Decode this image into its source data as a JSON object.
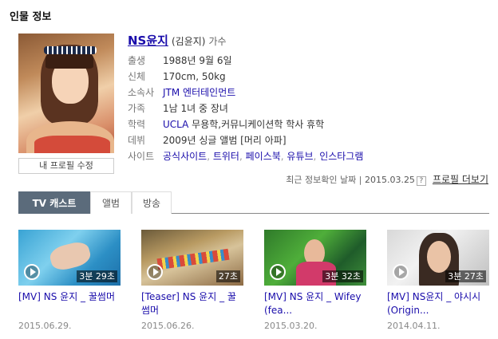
{
  "section": {
    "title": "인물 정보"
  },
  "profile": {
    "name": "NS윤지",
    "real_name": "(김윤지)",
    "job": "가수",
    "edit_button": "내 프로필 수정",
    "rows": [
      {
        "label": "출생",
        "value": "1988년 9월 6일"
      },
      {
        "label": "신체",
        "value": "170cm, 50kg"
      },
      {
        "label": "소속사",
        "link": "JTM 엔터테인먼트"
      },
      {
        "label": "가족",
        "value": "1남 1녀 중 장녀"
      },
      {
        "label": "학력",
        "link": "UCLA",
        "value": " 무용학,커뮤니케이션학 학사 휴학"
      },
      {
        "label": "데뷔",
        "value": "2009년 싱글 앨범 [머리 아파]"
      },
      {
        "label": "사이트",
        "links": [
          "공식사이트",
          "트위터",
          "페이스북",
          "유튜브",
          "인스타그램"
        ]
      }
    ]
  },
  "update": {
    "label": "최근 정보확인 날짜",
    "date": "2015.03.25",
    "help": "?",
    "more": "프로필 더보기"
  },
  "tabs": [
    {
      "label": "TV 캐스트",
      "active": true
    },
    {
      "label": "앨범",
      "active": false
    },
    {
      "label": "방송",
      "active": false
    }
  ],
  "videos": [
    {
      "title": "[MV] NS 윤지 _ 꿀썸머",
      "duration": "3분 29초",
      "date": "2015.06.29."
    },
    {
      "title": "[Teaser] NS 윤지 _ 꿀썸머",
      "duration": "27초",
      "date": "2015.06.26."
    },
    {
      "title": "[MV] NS 윤지 _ Wifey (fea...",
      "duration": "3분 32초",
      "date": "2015.03.20."
    },
    {
      "title": "[MV] NS윤지 _ 야시시 (Origin...",
      "duration": "3분 27초",
      "date": "2014.04.11."
    }
  ],
  "colors": {
    "link": "#1a0dab",
    "tab_active_bg": "#5b6b7b"
  }
}
